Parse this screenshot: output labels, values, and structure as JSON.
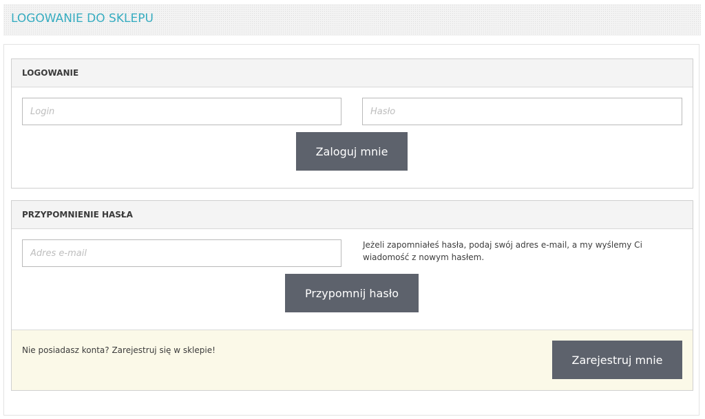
{
  "header": {
    "title": "LOGOWANIE DO SKLEPU"
  },
  "login": {
    "title": "LOGOWANIE",
    "login_placeholder": "Login",
    "password_placeholder": "Hasło",
    "submit_label": "Zaloguj mnie"
  },
  "reminder": {
    "title": "PRZYPOMNIENIE HASŁA",
    "email_placeholder": "Adres e-mail",
    "info": "Jeżeli zapomniałeś hasła, podaj swój adres e-mail, a my wyślemy Ci wiadomość z nowym hasłem.",
    "submit_label": "Przypomnij hasło"
  },
  "register": {
    "text": "Nie posiadasz konta? Zarejestruj się w sklepie!",
    "button_label": "Zarejestruj mnie"
  },
  "colors": {
    "title_accent": "#36acc0",
    "button_bg": "#5d626c",
    "register_bg": "#fbf9e8"
  }
}
